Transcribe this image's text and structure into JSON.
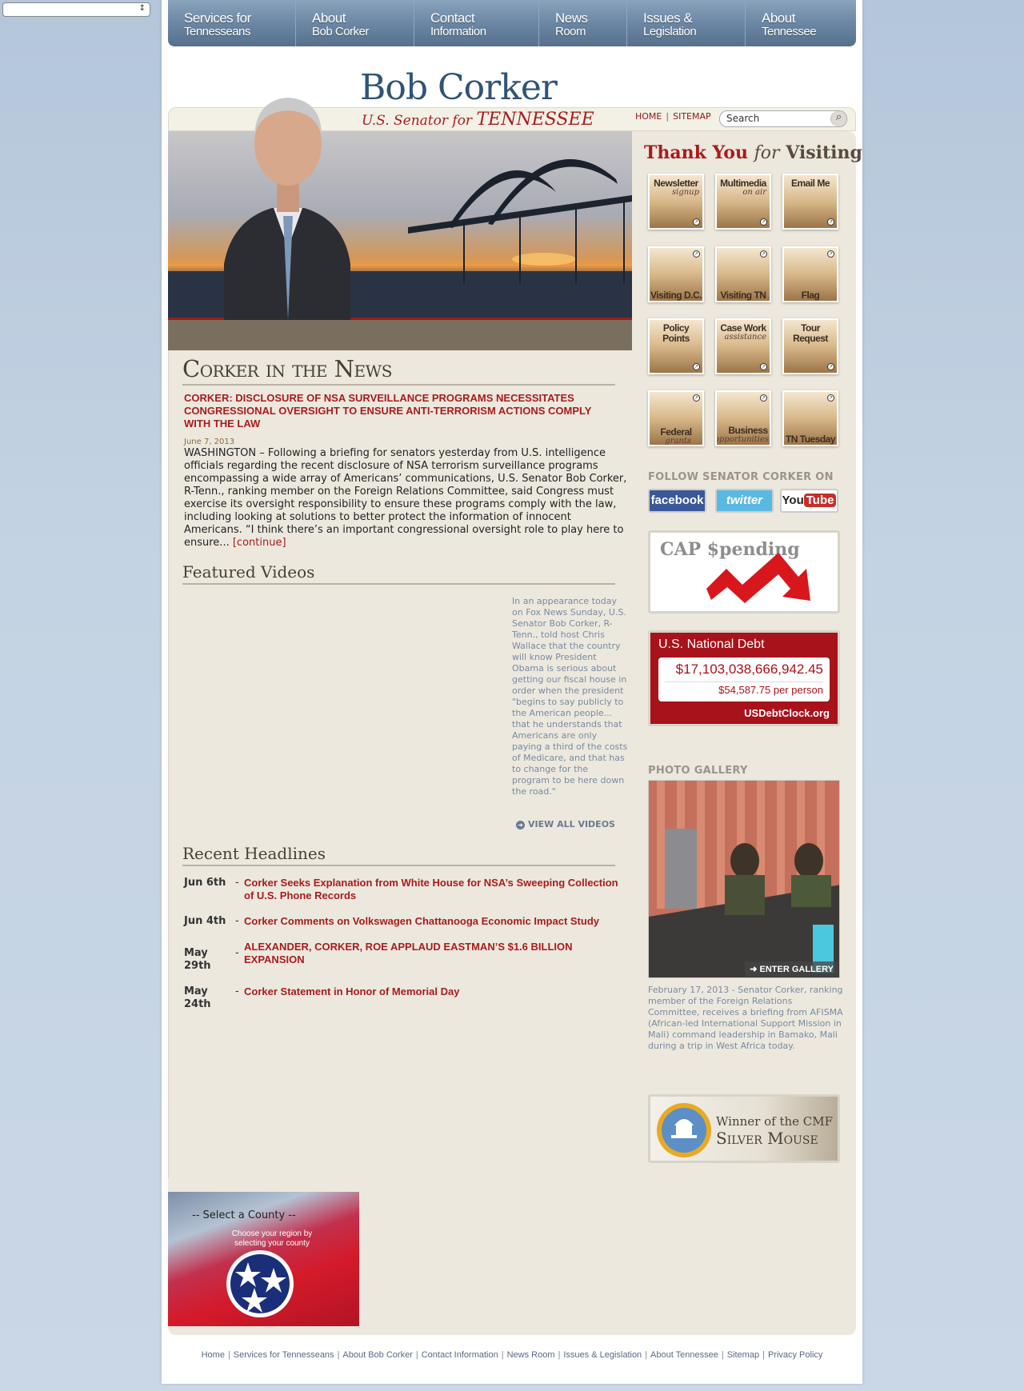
{
  "top_select": {
    "value": ""
  },
  "nav": {
    "items": [
      {
        "l1": "Services for",
        "l2": "Tennesseans"
      },
      {
        "l1": "About",
        "l2": "Bob Corker"
      },
      {
        "l1": "Contact",
        "l2": "Information"
      },
      {
        "l1": "News",
        "l2": "Room"
      },
      {
        "l1": "Issues &",
        "l2": "Legislation"
      },
      {
        "l1": "About",
        "l2": "Tennessee"
      }
    ]
  },
  "header": {
    "name": "Bob Corker",
    "subtitle_pre": "U.S. Senator for",
    "subtitle_state": "TENNESSEE",
    "links": [
      "HOME",
      "SITEMAP"
    ],
    "search_placeholder": "Search"
  },
  "news": {
    "section_title": "Corker in the News",
    "headline": "CORKER: DISCLOSURE OF NSA SURVEILLANCE PROGRAMS NECESSITATES CONGRESSIONAL OVERSIGHT TO ENSURE ANTI-TERRORISM ACTIONS COMPLY WITH THE LAW",
    "date": "June 7, 2013",
    "body": "WASHINGTON – Following a briefing for senators yesterday from U.S. intelligence officials regarding the recent disclosure of NSA terrorism surveillance programs encompassing a wide array of Americans’ communications, U.S. Senator Bob Corker, R-Tenn., ranking member on the Foreign Relations Committee, said Congress must exercise its oversight responsibility to ensure these programs comply with the law, including looking at solutions to better protect the information of innocent Americans. “I think there’s an important congressional oversight role to play here to ensure...",
    "continue": "[continue]"
  },
  "videos": {
    "section_title": "Featured Videos",
    "caption": "In an appearance today on Fox News Sunday, U.S. Senator Bob Corker, R-Tenn., told host Chris Wallace that the country will know President Obama is serious about getting our fiscal house in order when the president \"begins to say publicly to the American people... that he understands that Americans are only paying a third of the costs of Medicare, and that has to change for the program to be here down the road.\"",
    "view_all": "VIEW ALL VIDEOS"
  },
  "headlines": {
    "section_title": "Recent Headlines",
    "items": [
      {
        "date": "Jun 6th",
        "title": "Corker Seeks Explanation from White House for NSA’s Sweeping Collection of U.S. Phone Records"
      },
      {
        "date": "Jun 4th",
        "title": "Corker Comments on Volkswagen Chattanooga Economic Impact Study"
      },
      {
        "date": "May 29th",
        "title": "ALEXANDER, CORKER, ROE APPLAUD EASTMAN’S $1.6 BILLION EXPANSION"
      },
      {
        "date": "May 24th",
        "title": "Corker Statement in Honor of Memorial Day"
      }
    ]
  },
  "sidebar": {
    "thank_you": {
      "a": "Thank You",
      "b": "for",
      "c": "Visiting"
    },
    "tiles": [
      {
        "label": "Newsletter",
        "sub": "signup"
      },
      {
        "label": "Multimedia",
        "sub": "on air"
      },
      {
        "label": "Email Me",
        "sub": ""
      },
      {
        "label": "Visiting D.C.",
        "sub": ""
      },
      {
        "label": "Visiting TN",
        "sub": ""
      },
      {
        "label": "Flag Request",
        "sub": ""
      },
      {
        "label": "Policy Points",
        "sub": ""
      },
      {
        "label": "Case Work",
        "sub": "assistance"
      },
      {
        "label": "Tour Request",
        "sub": ""
      },
      {
        "label": "Federal",
        "sub": "grants"
      },
      {
        "label": "Business",
        "sub": "opportunities"
      },
      {
        "label": "TN Tuesday",
        "sub": ""
      }
    ],
    "follow_title": "FOLLOW SENATOR CORKER ON",
    "social": {
      "facebook": "facebook",
      "twitter": "twitter",
      "youtube_you": "You",
      "youtube_tube": "Tube"
    },
    "cap_title": "CAP $pending",
    "debt": {
      "title": "U.S. National Debt",
      "amount": "$17,103,038,666,942.45",
      "per_person": "$54,587.75 per person",
      "source": "USDebtClock.org"
    },
    "photo_title": "PHOTO GALLERY",
    "enter_gallery": "ENTER GALLERY",
    "photo_caption": "February 17, 2013 - Senator Corker, ranking member of the Foreign Relations Committee, receives a briefing from AFISMA (African-led International Support Mission in Mali) command leadership in Bamako, Mali during a trip in West Africa today.",
    "cmf": {
      "l1": "Winner of the CMF",
      "l2": "Silver Mouse"
    }
  },
  "county": {
    "select": "-- Select a County --",
    "hint": "Choose your region by selecting your county"
  },
  "footer": {
    "links": [
      "Home",
      "Services for Tennesseans",
      "About Bob Corker",
      "Contact Information",
      "News Room",
      "Issues & Legislation",
      "About Tennessee",
      "Sitemap",
      "Privacy Policy"
    ]
  },
  "colors": {
    "accent_red": "#a81c1c",
    "nav_blue": "#6c87a4",
    "brand_blue": "#2f5476",
    "tan_bg": "#ece8de"
  }
}
